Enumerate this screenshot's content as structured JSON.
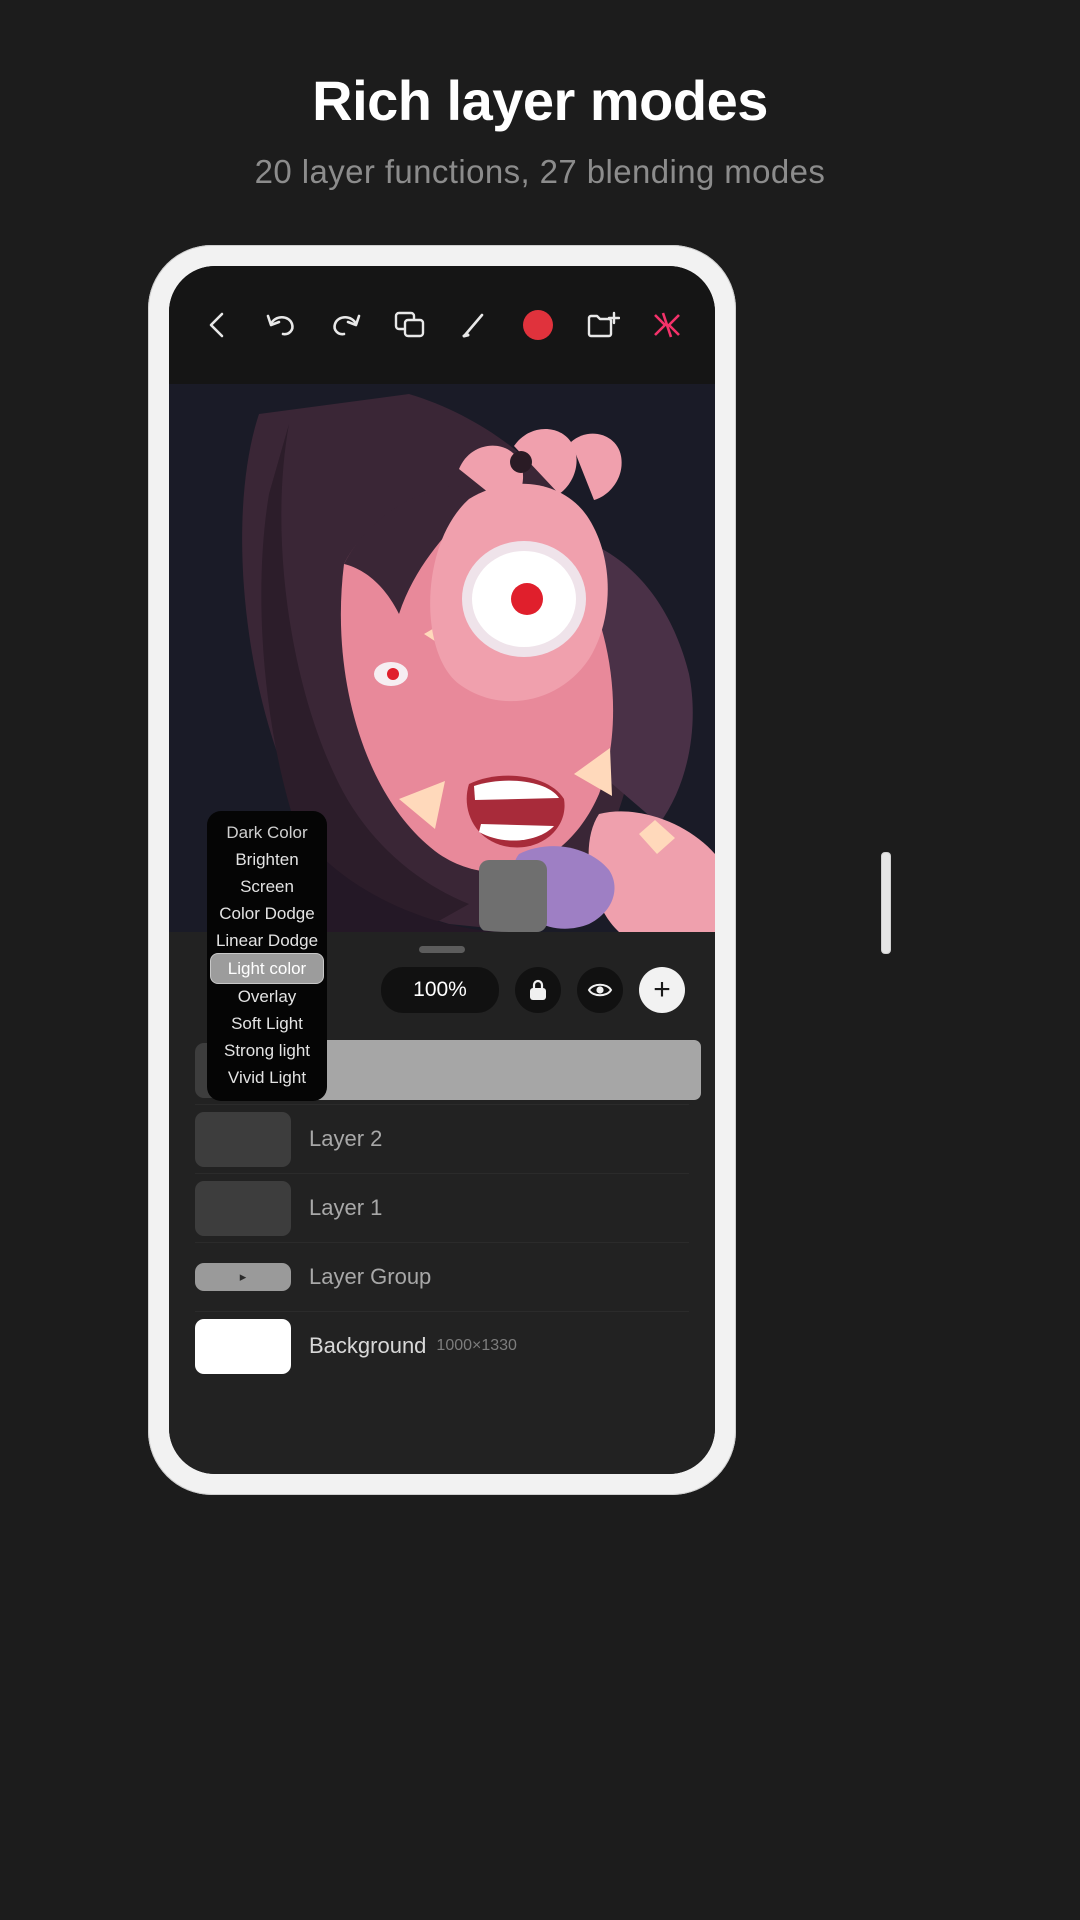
{
  "header": {
    "title": "Rich layer modes",
    "subtitle": "20 layer functions, 27 blending modes"
  },
  "toolbar": {
    "items": [
      {
        "name": "back-icon",
        "label": "Back"
      },
      {
        "name": "undo-icon",
        "label": "Undo"
      },
      {
        "name": "redo-icon",
        "label": "Redo"
      },
      {
        "name": "layers-copy-icon",
        "label": "Layers"
      },
      {
        "name": "brush-icon",
        "label": "Brush"
      },
      {
        "name": "color-swatch-icon",
        "label": "Color"
      },
      {
        "name": "add-layer-icon",
        "label": "Add layer"
      },
      {
        "name": "app-logo-icon",
        "label": "App menu"
      }
    ],
    "color_swatch": "#e0323c",
    "logo_color": "#f4326a"
  },
  "panel": {
    "opacity": "100%",
    "lock_icon": "lock-icon",
    "visibility_icon": "eye-icon",
    "add_icon": "plus-icon",
    "add_label": "+"
  },
  "blend_menu": {
    "items": [
      {
        "label": "Dark Color",
        "selected": false,
        "clipped": true
      },
      {
        "label": "Brighten",
        "selected": false,
        "clipped": false
      },
      {
        "label": "Screen",
        "selected": false,
        "clipped": false
      },
      {
        "label": "Color Dodge",
        "selected": false,
        "clipped": false
      },
      {
        "label": "Linear Dodge",
        "selected": false,
        "clipped": false
      },
      {
        "label": "Light color",
        "selected": true,
        "clipped": false
      },
      {
        "label": "Overlay",
        "selected": false,
        "clipped": false
      },
      {
        "label": "Soft Light",
        "selected": false,
        "clipped": false
      },
      {
        "label": "Strong light",
        "selected": false,
        "clipped": false
      },
      {
        "label": "Vivid Light",
        "selected": false,
        "clipped": false
      }
    ]
  },
  "layers": [
    {
      "name": "",
      "dims": "",
      "selected": true,
      "thumb": "dark",
      "type": "layer"
    },
    {
      "name": "Layer 2",
      "dims": "",
      "selected": false,
      "thumb": "dark",
      "type": "layer"
    },
    {
      "name": "Layer 1",
      "dims": "",
      "selected": false,
      "thumb": "dark",
      "type": "layer"
    },
    {
      "name": "Layer Group",
      "dims": "",
      "selected": false,
      "thumb": "group",
      "type": "group",
      "expander": "▸"
    },
    {
      "name": "Background",
      "dims": "1000×1330",
      "selected": false,
      "thumb": "white",
      "type": "layer"
    }
  ],
  "colors": {
    "page_bg": "#1c1c1c",
    "phone_frame": "#f2f2f2",
    "app_bg": "#151515",
    "panel_bg": "#222222",
    "canvas_bg": "#191a26",
    "accent_pink": "#f4326a",
    "selected_row": "#a6a6a6"
  }
}
